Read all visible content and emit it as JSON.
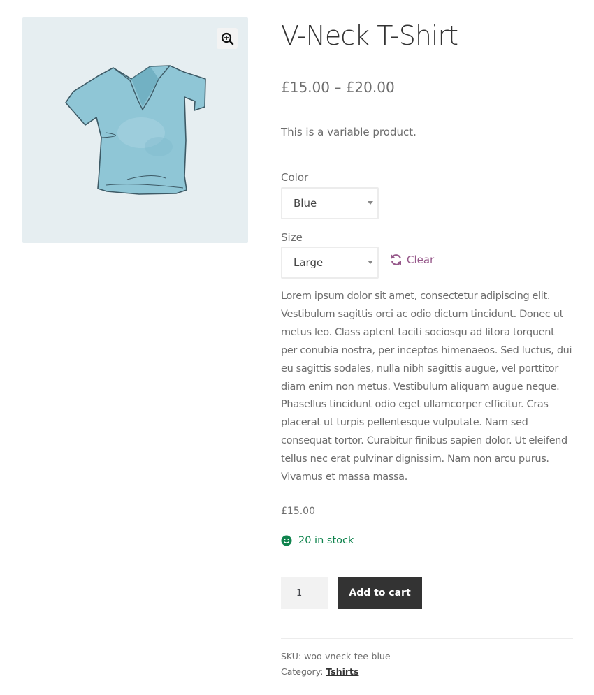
{
  "product": {
    "title": "V-Neck T-Shirt",
    "price_range": "£15.00 – £20.00",
    "short_description": "This is a variable product.",
    "image": {
      "icon": "v-neck-tshirt-image",
      "color": "#8fc6d6"
    }
  },
  "gallery": {
    "zoom_icon": "magnifier-plus-icon"
  },
  "variations": {
    "color": {
      "label": "Color",
      "selected": "Blue"
    },
    "size": {
      "label": "Size",
      "selected": "Large"
    },
    "clear_label": "Clear",
    "clear_icon": "refresh-icon"
  },
  "description": "Lorem ipsum dolor sit amet, consectetur adipiscing elit. Vestibulum sagittis orci ac odio dictum tincidunt. Donec ut metus leo. Class aptent taciti sociosqu ad litora torquent per conubia nostra, per inceptos himenaeos. Sed luctus, dui eu sagittis sodales, nulla nibh sagittis augue, vel porttitor diam enim non metus. Vestibulum aliquam augue neque. Phasellus tincidunt odio eget ullamcorper efficitur. Cras placerat ut turpis pellentesque vulputate. Nam sed consequat tortor. Curabitur finibus sapien dolor. Ut eleifend tellus nec erat pulvinar dignissim. Nam non arcu purus. Vivamus et massa massa.",
  "variation_price": "£15.00",
  "stock": {
    "text": "20 in stock",
    "icon": "smiley-icon",
    "color": "#0f834d"
  },
  "cart": {
    "quantity": "1",
    "button_label": "Add to cart"
  },
  "meta": {
    "sku_label": "SKU:",
    "sku": "woo-vneck-tee-blue",
    "category_label": "Category:",
    "category": "Tshirts"
  },
  "colors": {
    "accent": "#96588a",
    "button_bg": "#333333",
    "text": "#6d6d6d"
  }
}
